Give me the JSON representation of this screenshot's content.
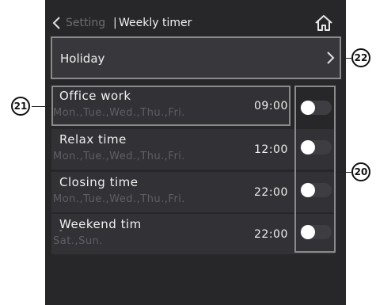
{
  "header": {
    "back_label": "Setting",
    "separator": "|",
    "title": "Weekly timer",
    "home_icon": "home-icon"
  },
  "holiday": {
    "label": "Holiday",
    "arrow": "chevron-right-icon"
  },
  "timers": [
    {
      "name": "Office work",
      "days": "Mon.,Tue.,Wed.,Thu.,Fri.",
      "time": "09:00",
      "enabled": false
    },
    {
      "name": "Relax time",
      "days": "Mon.,Tue.,Wed.,Thu.,Fri.",
      "time": "12:00",
      "enabled": false
    },
    {
      "name": "Closing time",
      "days": "Mon.,Tue.,Wed.,Thu.,Fri.",
      "time": "22:00",
      "enabled": false
    },
    {
      "name": "Weekend tim",
      "days": "Sat.,Sun.",
      "time": "22:00",
      "enabled": false
    }
  ],
  "callouts": {
    "toggles": "20",
    "timer_item": "21",
    "holiday": "22"
  },
  "colors": {
    "screen_bg": "#27272a",
    "row_bg": "#323236",
    "knob": "#ffffff",
    "muted_text": "#5e5e64"
  }
}
